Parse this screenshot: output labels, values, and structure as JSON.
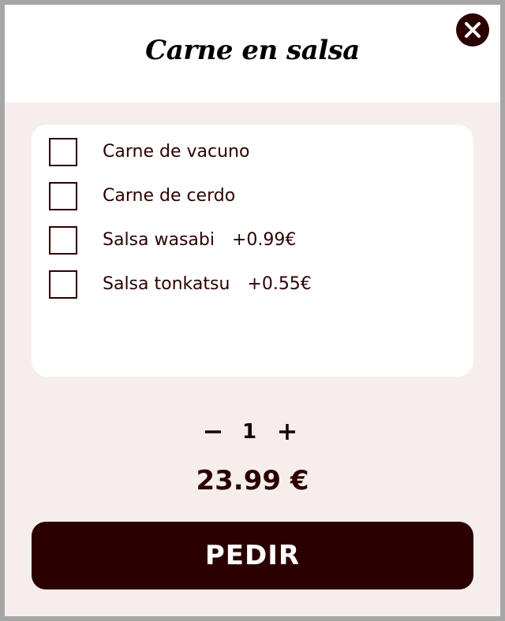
{
  "dialog": {
    "title": "Carne en salsa",
    "close_icon": "close-icon"
  },
  "options": [
    {
      "label": "Carne de vacuno",
      "price": "",
      "checked": false
    },
    {
      "label": "Carne de cerdo",
      "price": "",
      "checked": false
    },
    {
      "label": "Salsa wasabi",
      "price": "+0.99€",
      "checked": false
    },
    {
      "label": "Salsa tonkatsu",
      "price": "+0.55€",
      "checked": false
    }
  ],
  "quantity": {
    "value": "1",
    "decrement_icon": "minus-icon",
    "increment_icon": "plus-icon"
  },
  "total_price": "23.99 €",
  "order_button": {
    "label": "PEDIR"
  },
  "colors": {
    "accent": "#2b0000",
    "background": "#f6eeec",
    "card": "#ffffff"
  }
}
